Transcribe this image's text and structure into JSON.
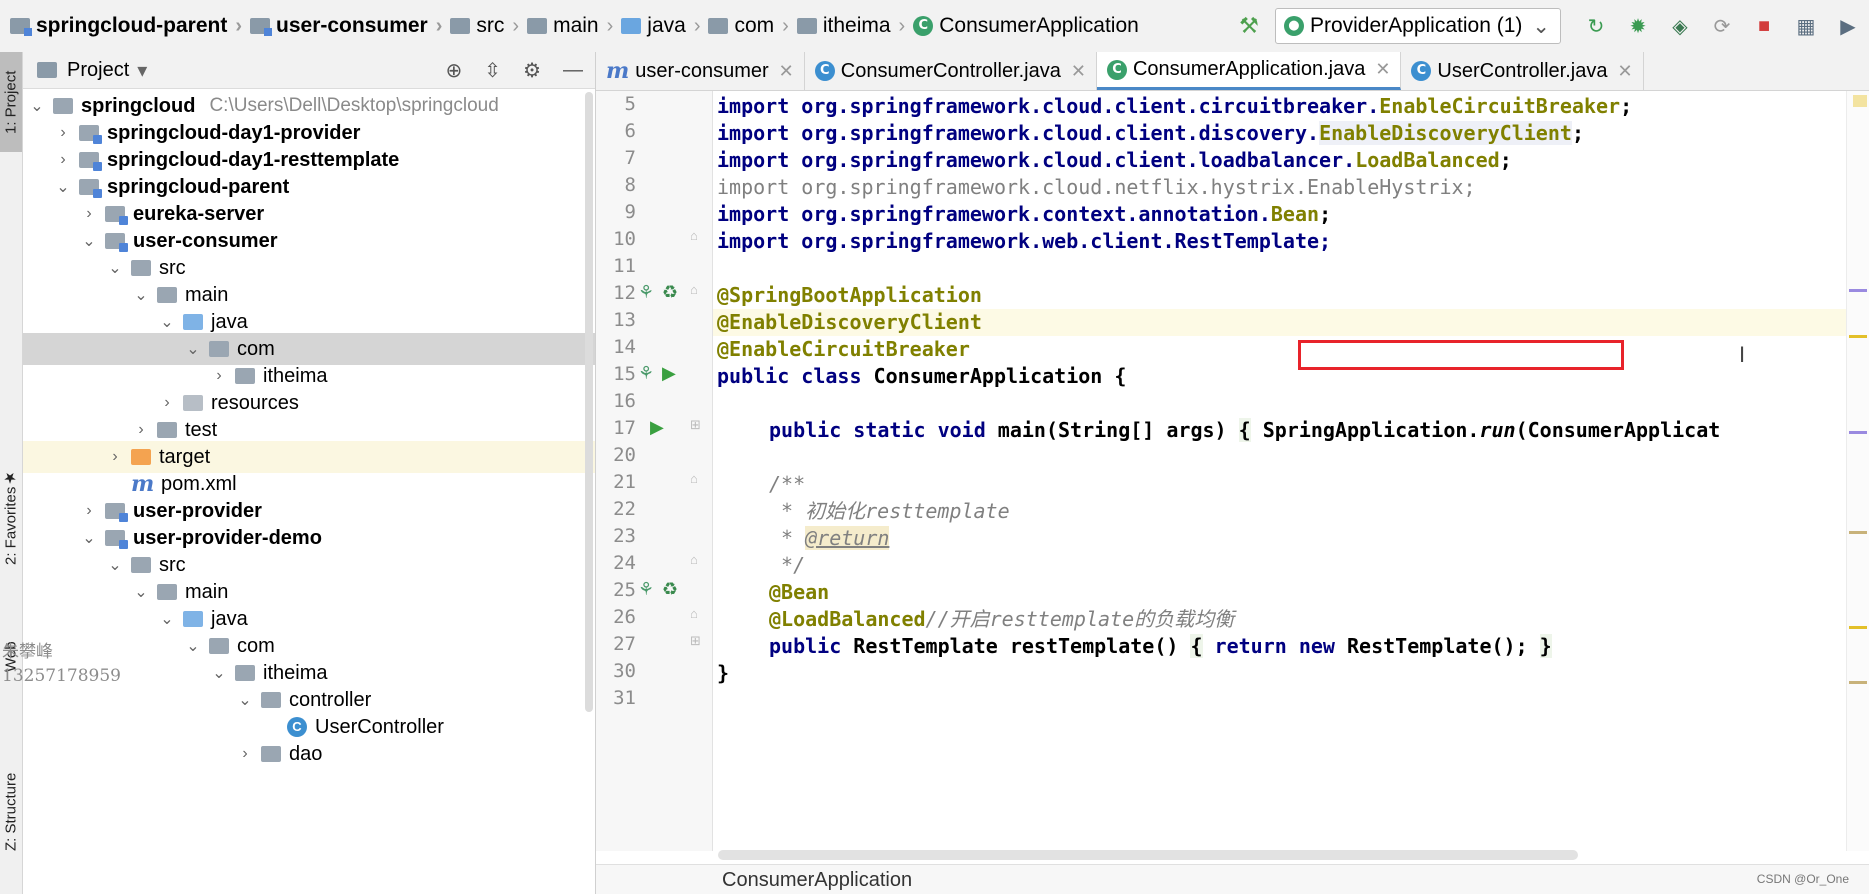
{
  "navbar": {
    "breadcrumbs": [
      "springcloud-parent",
      "user-consumer",
      "src",
      "main",
      "java",
      "com",
      "itheima",
      "ConsumerApplication"
    ],
    "run_config": "ProviderApplication (1)"
  },
  "left_strip": {
    "tabs": [
      "1: Project",
      "2: Favorites",
      "Web",
      "Z: Structure"
    ]
  },
  "project": {
    "header_title": "Project",
    "tree": [
      {
        "label": "springcloud",
        "path": "C:\\Users\\Dell\\Desktop\\springcloud",
        "bold": true
      },
      {
        "label": "springcloud-day1-provider",
        "bold": true
      },
      {
        "label": "springcloud-day1-resttemplate",
        "bold": true
      },
      {
        "label": "springcloud-parent",
        "bold": true
      },
      {
        "label": "eureka-server",
        "bold": true
      },
      {
        "label": "user-consumer",
        "bold": true
      },
      {
        "label": "src"
      },
      {
        "label": "main"
      },
      {
        "label": "java"
      },
      {
        "label": "com"
      },
      {
        "label": "itheima"
      },
      {
        "label": "resources"
      },
      {
        "label": "test"
      },
      {
        "label": "target"
      },
      {
        "label": "pom.xml"
      },
      {
        "label": "user-provider",
        "bold": true
      },
      {
        "label": "user-provider-demo",
        "bold": true
      },
      {
        "label": "src"
      },
      {
        "label": "main"
      },
      {
        "label": "java"
      },
      {
        "label": "com"
      },
      {
        "label": "itheima"
      },
      {
        "label": "controller"
      },
      {
        "label": "UserController"
      },
      {
        "label": "dao"
      }
    ]
  },
  "watermark": {
    "line1": "朱攀峰",
    "line2": "13257178959"
  },
  "editor": {
    "tabs": [
      {
        "label": "user-consumer"
      },
      {
        "label": "ConsumerController.java"
      },
      {
        "label": "ConsumerApplication.java"
      },
      {
        "label": "UserController.java"
      }
    ],
    "line_numbers": [
      "5",
      "6",
      "7",
      "8",
      "9",
      "10",
      "11",
      "12",
      "13",
      "14",
      "15",
      "16",
      "17",
      "20",
      "21",
      "22",
      "23",
      "24",
      "25",
      "26",
      "27",
      "30",
      "31"
    ],
    "code": {
      "l5_pre": "import org.springframework.cloud.client.circuitbreaker.",
      "l5_cls": "EnableCircuitBreaker",
      "l5_end": ";",
      "l6_pre": "import org.springframework.cloud.client.discovery.",
      "l6_cls": "EnableDiscoveryClient",
      "l6_end": ";",
      "l7_pre": "import org.springframework.cloud.client.loadbalancer.",
      "l7_cls": "LoadBalanced",
      "l7_end": ";",
      "l8": "import org.springframework.cloud.netflix.hystrix.EnableHystrix;",
      "l9_pre": "import org.springframework.context.annotation.",
      "l9_cls": "Bean",
      "l9_end": ";",
      "l10": "import org.springframework.web.client.RestTemplate;",
      "l12": "@SpringBootApplication",
      "l13": "@EnableDiscoveryClient",
      "l14": "@EnableCircuitBreaker",
      "l15_kw": "public class",
      "l15_rest": " ConsumerApplication {",
      "l17_kw": "public static void",
      "l17_mid": " main(String[] args) ",
      "l17_brace": "{",
      "l17_body": " SpringApplication.",
      "l17_run": "run",
      "l17_tail": "(ConsumerApplicat",
      "l21": "/**",
      "l22_star": " * ",
      "l22_txt": "初始化resttemplate",
      "l23_star": " * ",
      "l23_tag": "@return",
      "l24": " */",
      "l25": "@Bean",
      "l26_ann": "@LoadBalanced",
      "l26_cm": "//开启resttemplate的负载均衡",
      "l27_kw": "public",
      "l27_mid": " RestTemplate restTemplate() ",
      "l27_b1": "{",
      "l27_ret": " return",
      "l27_new": " new",
      "l27_tail": " RestTemplate(); ",
      "l27_b2": "}",
      "l30": "}"
    },
    "bottom_breadcrumb": "ConsumerApplication"
  },
  "footer_watermark": "CSDN @Or_One",
  "colors": {
    "keyword": "#000080",
    "annotation": "#808000",
    "highlight_box": "#e8232a"
  }
}
